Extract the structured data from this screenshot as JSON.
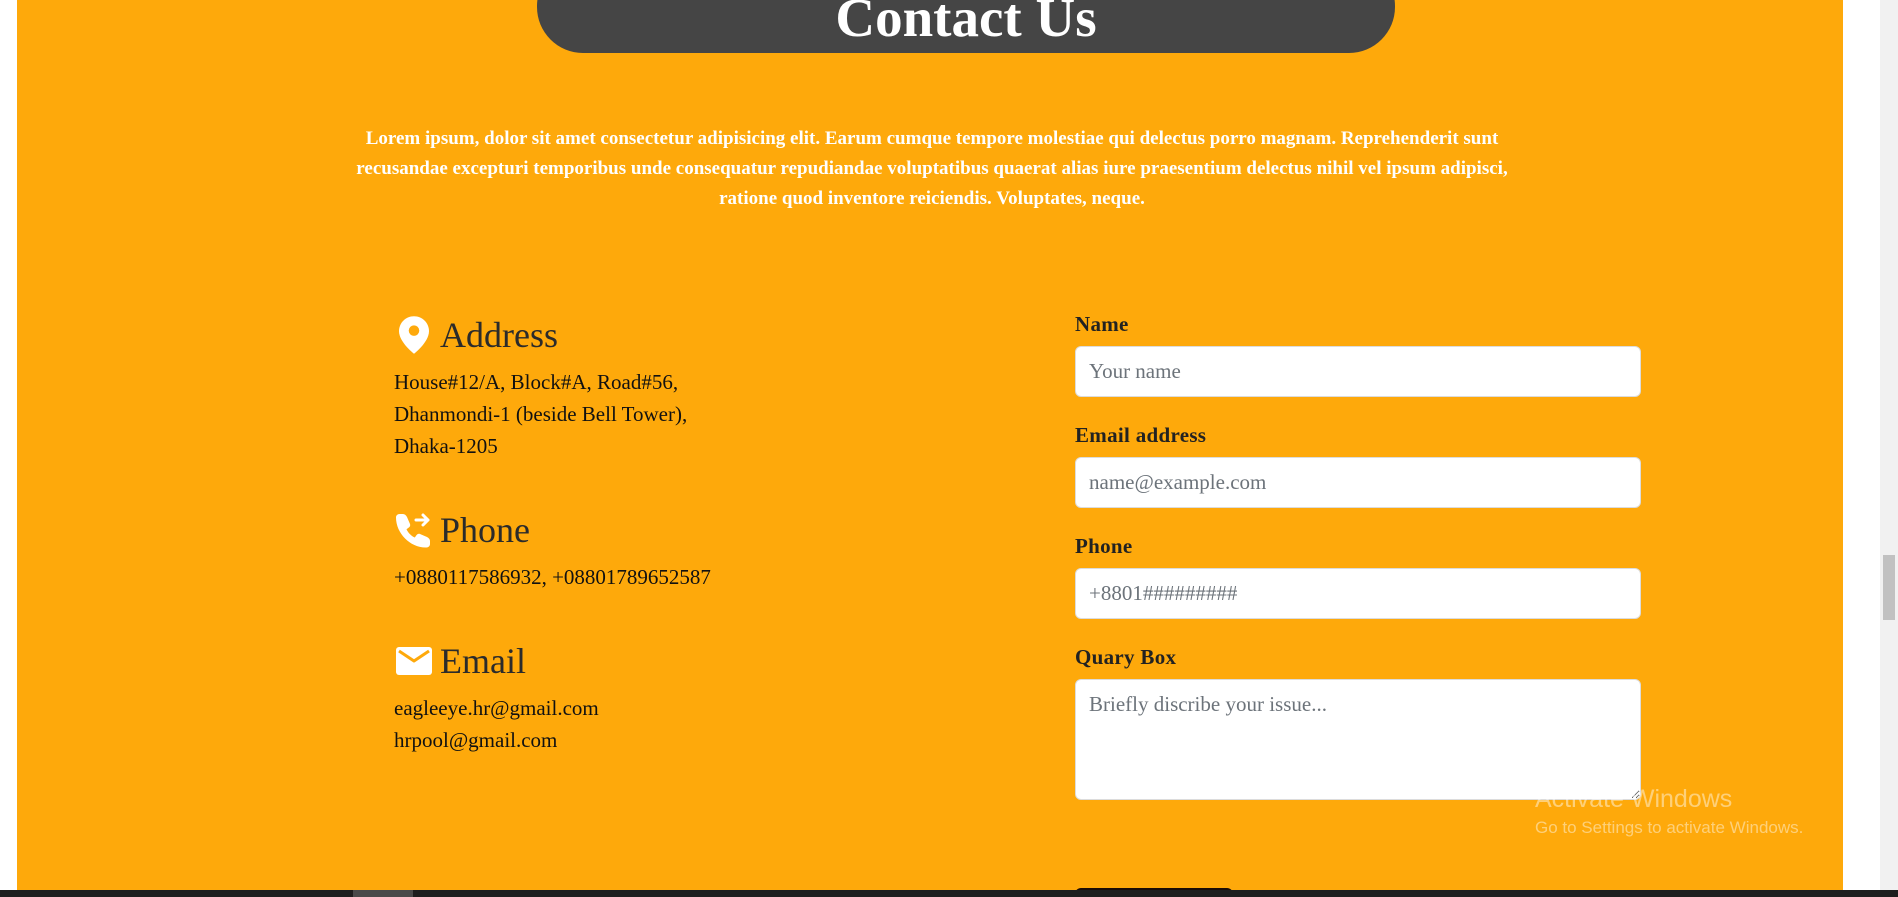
{
  "section": {
    "title": "Contact Us",
    "intro": "Lorem ipsum, dolor sit amet consectetur adipisicing elit. Earum cumque tempore molestiae qui delectus porro magnam. Reprehenderit sunt recusandae excepturi temporibus unde consequatur repudiandae voluptatibus quaerat alias iure praesentium delectus nihil vel ipsum adipisci, ratione quod inventore reiciendis. Voluptates, neque."
  },
  "contact_info": {
    "address": {
      "icon": "location-pin-icon",
      "heading": "Address",
      "lines": [
        "House#12/A, Block#A, Road#56,",
        "Dhanmondi-1 (beside Bell Tower),",
        "Dhaka-1205"
      ]
    },
    "phone": {
      "icon": "phone-forward-icon",
      "heading": "Phone",
      "lines": [
        "+0880117586932, +08801789652587"
      ]
    },
    "email": {
      "icon": "envelope-icon",
      "heading": "Email",
      "lines": [
        "eagleeye.hr@gmail.com",
        "hrpool@gmail.com"
      ]
    }
  },
  "form": {
    "name_label": "Name",
    "name_placeholder": "Your name",
    "email_label": "Email address",
    "email_placeholder": "name@example.com",
    "phone_label": "Phone",
    "phone_placeholder": "+8801#########",
    "query_label": "Quary Box",
    "query_placeholder": "Briefly discribe your issue..."
  },
  "watermark": {
    "line1": "Activate Windows",
    "line2": "Go to Settings to activate Windows."
  },
  "colors": {
    "background": "#fea90b",
    "title_pill": "#454545",
    "text_dark": "#222222",
    "white": "#ffffff"
  }
}
